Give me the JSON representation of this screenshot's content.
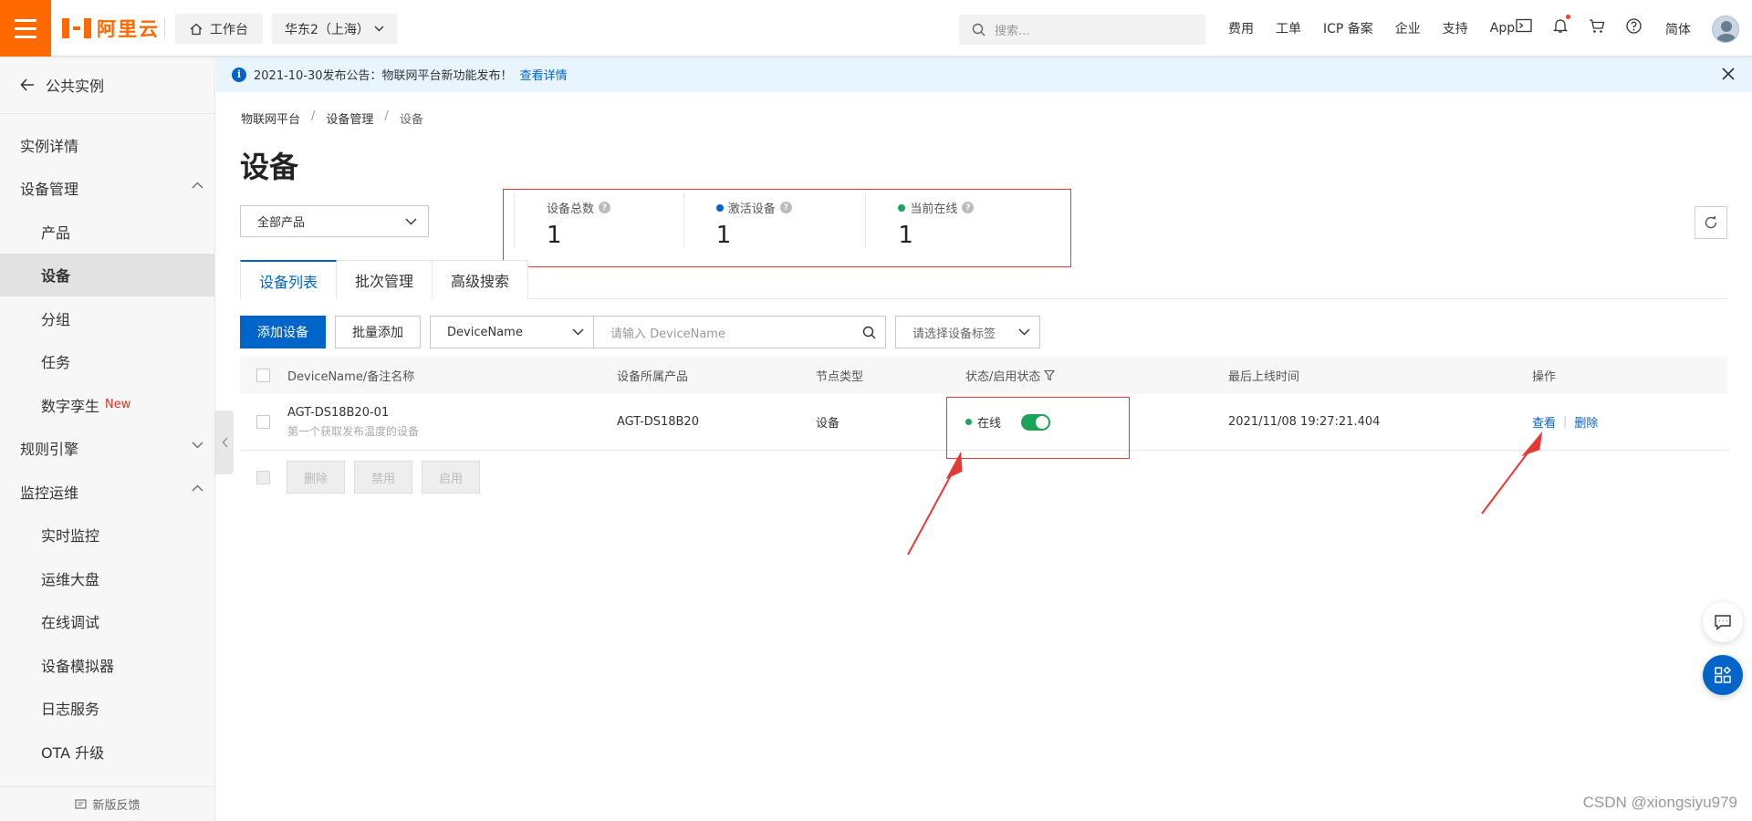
{
  "topbar": {
    "logo_text": "阿里云",
    "workbench_label": "工作台",
    "region_label": "华东2（上海）",
    "search_placeholder": "搜索...",
    "links": [
      "费用",
      "工单",
      "ICP 备案",
      "企业",
      "支持",
      "App"
    ],
    "lang": "简体"
  },
  "notice": {
    "text": "2021-10-30发布公告：物联网平台新功能发布！",
    "link": "查看详情"
  },
  "sidebar": {
    "back_label": "公共实例",
    "items": [
      {
        "label": "实例详情"
      },
      {
        "label": "设备管理"
      },
      {
        "label": "产品"
      },
      {
        "label": "设备"
      },
      {
        "label": "分组"
      },
      {
        "label": "任务"
      },
      {
        "label": "数字孪生",
        "badge": "New"
      },
      {
        "label": "规则引擎"
      },
      {
        "label": "监控运维"
      },
      {
        "label": "实时监控"
      },
      {
        "label": "运维大盘"
      },
      {
        "label": "在线调试"
      },
      {
        "label": "设备模拟器"
      },
      {
        "label": "日志服务"
      },
      {
        "label": "OTA 升级"
      }
    ],
    "feedback": "新版反馈"
  },
  "breadcrumb": [
    "物联网平台",
    "设备管理",
    "设备"
  ],
  "page_title": "设备",
  "product_select": "全部产品",
  "stats": [
    {
      "label": "设备总数",
      "value": "1",
      "dot_color": ""
    },
    {
      "label": "激活设备",
      "value": "1",
      "dot_color": "#0064c8"
    },
    {
      "label": "当前在线",
      "value": "1",
      "dot_color": "#1ca35a"
    }
  ],
  "tabs": [
    "设备列表",
    "批次管理",
    "高级搜索"
  ],
  "toolbar": {
    "add_label": "添加设备",
    "batch_add_label": "批量添加",
    "field_select": "DeviceName",
    "input_placeholder": "请输入 DeviceName",
    "tag_placeholder": "请选择设备标签"
  },
  "table": {
    "headers": [
      "DeviceName/备注名称",
      "设备所属产品",
      "节点类型",
      "状态/启用状态",
      "最后上线时间",
      "操作"
    ],
    "rows": [
      {
        "name": "AGT-DS18B20-01",
        "remark": "第一个获取发布温度的设备",
        "product": "AGT-DS18B20",
        "node_type": "设备",
        "status": "在线",
        "enabled": true,
        "last_online": "2021/11/08 19:27:21.404",
        "actions": [
          "查看",
          "删除"
        ]
      }
    ]
  },
  "bulk_actions": [
    "删除",
    "禁用",
    "启用"
  ],
  "watermark": "CSDN @xiongsiyu979",
  "colors": {
    "brand": "#ff6a00",
    "primary": "#0064c8",
    "online": "#1ca35a",
    "annotation": "#e53935"
  }
}
